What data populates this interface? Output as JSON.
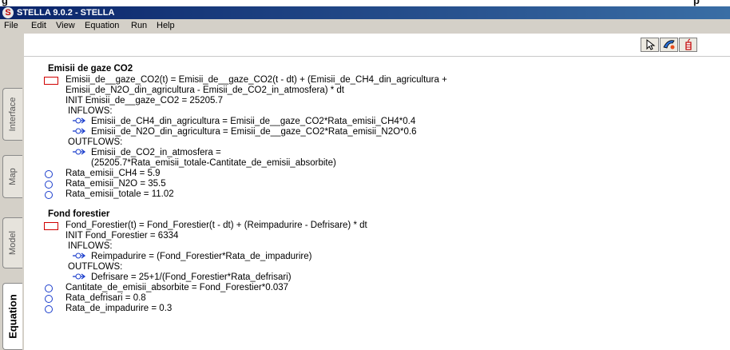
{
  "window": {
    "title": "STELLA 9.0.2 - STELLA",
    "app_icon": "stella-logo-icon"
  },
  "menubar": [
    "File",
    "Edit",
    "View",
    "Equation",
    "Run",
    "Help"
  ],
  "toolbar": {
    "icons": [
      "pointer-icon",
      "hand-icon",
      "dynamite-icon"
    ]
  },
  "sidebar": {
    "tabs": [
      {
        "label": "Interface",
        "active": false
      },
      {
        "label": "Map",
        "active": false
      },
      {
        "label": "Model",
        "active": false
      },
      {
        "label": "Equation",
        "active": true
      }
    ]
  },
  "equations": {
    "section1": {
      "title": "Emisii de gaze CO2",
      "stock_eq_line1": "Emisii_de__gaze_CO2(t) = Emisii_de__gaze_CO2(t - dt) + (Emisii_de_CH4_din_agricultura +",
      "stock_eq_line2": "Emisii_de_N2O_din_agricultura - Emisii_de_CO2_in_atmosfera) * dt",
      "init": "INIT Emisii_de__gaze_CO2 = 25205.7",
      "inflows_label": "INFLOWS:",
      "inflow1": "Emisii_de_CH4_din_agricultura = Emisii_de__gaze_CO2*Rata_emisii_CH4*0.4",
      "inflow2": "Emisii_de_N2O_din_agricultura = Emisii_de__gaze_CO2*Rata_emisii_N2O*0.6",
      "outflows_label": "OUTFLOWS:",
      "outflow1_line1": "Emisii_de_CO2_in_atmosfera =",
      "outflow1_line2": "(25205.7*Rata_emisii_totale-Cantitate_de_emisii_absorbite)",
      "conv1": "Rata_emisii_CH4 = 5.9",
      "conv2": "Rata_emisii_N2O = 35.5",
      "conv3": "Rata_emisii_totale = 11.02"
    },
    "section2": {
      "title": "Fond forestier",
      "stock_eq": "Fond_Forestier(t) = Fond_Forestier(t - dt) + (Reimpadurire - Defrisare) * dt",
      "init": "INIT Fond_Forestier = 6334",
      "inflows_label": "INFLOWS:",
      "inflow1": "Reimpadurire = (Fond_Forestier*Rata_de_impadurire)",
      "outflows_label": "OUTFLOWS:",
      "outflow1": "Defrisare = 25+1/(Fond_Forestier*Rata_defrisari)",
      "conv1": "Cantitate_de_emisii_absorbite = Fond_Forestier*0.037",
      "conv2": "Rata_defrisari = 0.8",
      "conv3": "Rata_de_impadurire = 0.3"
    }
  },
  "top_fragment": {
    "left_text": "g",
    "right_text": "p"
  }
}
